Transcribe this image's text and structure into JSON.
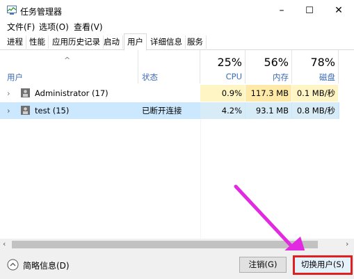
{
  "window": {
    "title": "任务管理器",
    "min": "–",
    "max": "☐",
    "close": "✕"
  },
  "menu": [
    {
      "label": "文件(F)"
    },
    {
      "label": "选项(O)"
    },
    {
      "label": "查看(V)"
    }
  ],
  "tabs": [
    {
      "label": "进程"
    },
    {
      "label": "性能"
    },
    {
      "label": "应用历史记录"
    },
    {
      "label": "启动"
    },
    {
      "label": "用户",
      "active": true
    },
    {
      "label": "详细信息"
    },
    {
      "label": "服务"
    }
  ],
  "header": {
    "sort_indicator": "^",
    "user_col": "用户",
    "status_col": "状态",
    "cpu": {
      "pct": "25%",
      "label": "CPU"
    },
    "mem": {
      "pct": "56%",
      "label": "内存"
    },
    "disk": {
      "pct": "78%",
      "label": "磁盘"
    }
  },
  "rows": [
    {
      "name": "Administrator (17)",
      "status": "",
      "cpu": "0.9%",
      "mem": "117.3 MB",
      "disk": "0.1 MB/秒",
      "selected": false
    },
    {
      "name": "test (15)",
      "status": "已断开连接",
      "cpu": "4.2%",
      "mem": "93.1 MB",
      "disk": "0.8 MB/秒",
      "selected": true
    }
  ],
  "footer": {
    "summary": "简略信息(D)",
    "logoff": "注销(G)",
    "switch": "切换用户(S)"
  },
  "colors": {
    "selected_row": "#cce8ff",
    "accent_arrow": "#e22ae0",
    "highlight_box": "#e02020"
  }
}
